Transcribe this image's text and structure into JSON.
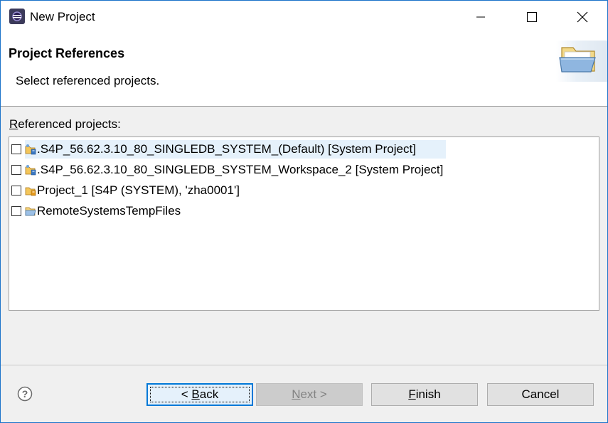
{
  "window": {
    "title": "New Project",
    "controls": {
      "minimize_icon": "minimize-icon",
      "maximize_icon": "maximize-icon",
      "close_icon": "close-icon"
    }
  },
  "banner": {
    "title": "Project References",
    "description": "Select referenced projects."
  },
  "list": {
    "label_prefix": "R",
    "label_rest": "eferenced projects:",
    "items": [
      {
        "text": ".S4P_56.62.3.10_80_SINGLEDB_SYSTEM_(Default) [System Project]",
        "checked": false,
        "icon": "abap-system-project-icon"
      },
      {
        "text": ".S4P_56.62.3.10_80_SINGLEDB_SYSTEM_Workspace_2 [System Project]",
        "checked": false,
        "icon": "abap-system-project-icon"
      },
      {
        "text": "Project_1 [S4P (SYSTEM), 'zha0001']",
        "checked": false,
        "icon": "abap-project-icon"
      },
      {
        "text": "RemoteSystemsTempFiles",
        "checked": false,
        "icon": "open-folder-icon"
      }
    ]
  },
  "buttons": {
    "back_prefix": "< ",
    "back_mnemonic": "B",
    "back_rest": "ack",
    "next_mnemonic": "N",
    "next_rest": "ext >",
    "finish_mnemonic": "F",
    "finish_rest": "inish",
    "cancel": "Cancel"
  },
  "colors": {
    "accent": "#0078d7",
    "selection": "#e5f1fb",
    "window_border": "#1b73c9"
  }
}
